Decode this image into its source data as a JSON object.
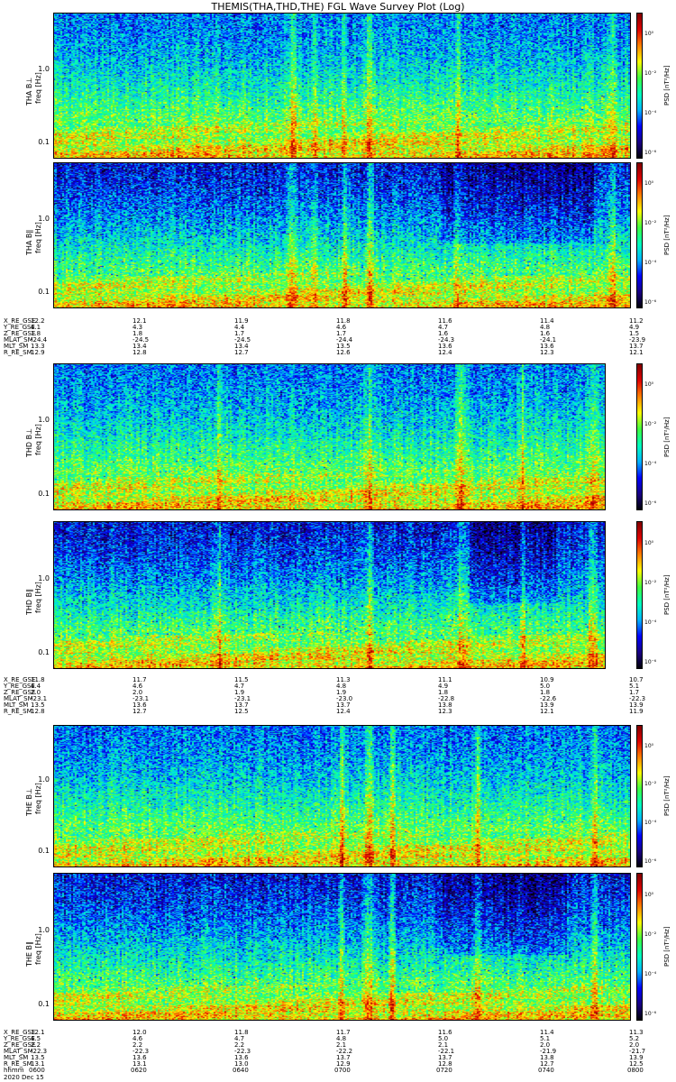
{
  "title": "THEMIS(THA,THD,THE) FGL Wave Survey Plot (Log)",
  "chart_data": [
    {
      "type": "heatmap",
      "probe": "THA",
      "panels": [
        {
          "ylabel_top": "THA B⊥",
          "ylabel_bottom": "freq [Hz]",
          "yscale": "log",
          "ylim": [
            0.06,
            6.0
          ],
          "yticks": [
            "1.0",
            "0.1"
          ],
          "colorbar_label": "PSD [nT²/Hz]",
          "colorbar_ticks": [
            "10⁰",
            "10⁻²",
            "10⁻⁴",
            "10⁻⁶"
          ]
        },
        {
          "ylabel_top": "THA B∥",
          "ylabel_bottom": "freq [Hz]",
          "yscale": "log",
          "ylim": [
            0.06,
            6.0
          ],
          "yticks": [
            "1.0",
            "0.1"
          ],
          "colorbar_label": "PSD [nT²/Hz]",
          "colorbar_ticks": [
            "10⁰",
            "10⁻²",
            "10⁻⁴",
            "10⁻⁶"
          ]
        }
      ],
      "ephemeris": [
        {
          "name": "X_RE_GSE",
          "values": [
            "12.2",
            "12.1",
            "11.9",
            "11.8",
            "11.6",
            "11.4",
            "11.2"
          ]
        },
        {
          "name": "Y_RE_GSE",
          "values": [
            "4.1",
            "4.3",
            "4.4",
            "4.6",
            "4.7",
            "4.8",
            "4.9"
          ]
        },
        {
          "name": "Z_RE_GSE",
          "values": [
            "1.8",
            "1.8",
            "1.7",
            "1.7",
            "1.6",
            "1.6",
            "1.5"
          ]
        },
        {
          "name": "MLAT_SM",
          "values": [
            "-24.4",
            "-24.5",
            "-24.5",
            "-24.4",
            "-24.3",
            "-24.1",
            "-23.9"
          ]
        },
        {
          "name": "MLT_SM",
          "values": [
            "13.3",
            "13.4",
            "13.4",
            "13.5",
            "13.6",
            "13.6",
            "13.7"
          ]
        },
        {
          "name": "R_RE_SM",
          "values": [
            "12.9",
            "12.8",
            "12.7",
            "12.6",
            "12.4",
            "12.3",
            "12.1"
          ]
        }
      ]
    },
    {
      "type": "heatmap",
      "probe": "THD",
      "panels": [
        {
          "ylabel_top": "THD B⊥",
          "ylabel_bottom": "freq [Hz]",
          "yscale": "log",
          "ylim": [
            0.06,
            6.0
          ],
          "yticks": [
            "1.0",
            "0.1"
          ],
          "colorbar_label": "PSD [nT²/Hz]",
          "colorbar_ticks": [
            "10⁰",
            "10⁻²",
            "10⁻⁴",
            "10⁻⁶"
          ]
        },
        {
          "ylabel_top": "THD B∥",
          "ylabel_bottom": "freq [Hz]",
          "yscale": "log",
          "ylim": [
            0.06,
            6.0
          ],
          "yticks": [
            "1.0",
            "0.1"
          ],
          "colorbar_label": "PSD [nT²/Hz]",
          "colorbar_ticks": [
            "10⁰",
            "10⁻²",
            "10⁻⁴",
            "10⁻⁶"
          ]
        }
      ],
      "ephemeris": [
        {
          "name": "X_RE_GSE",
          "values": [
            "11.8",
            "11.7",
            "11.5",
            "11.3",
            "11.1",
            "10.9",
            "10.7"
          ]
        },
        {
          "name": "Y_RE_GSE",
          "values": [
            "4.4",
            "4.6",
            "4.7",
            "4.8",
            "4.9",
            "5.0",
            "5.1"
          ]
        },
        {
          "name": "Z_RE_GSE",
          "values": [
            "2.0",
            "2.0",
            "1.9",
            "1.9",
            "1.8",
            "1.8",
            "1.7"
          ]
        },
        {
          "name": "MLAT_SM",
          "values": [
            "-23.1",
            "-23.1",
            "-23.1",
            "-23.0",
            "-22.8",
            "-22.6",
            "-22.3"
          ]
        },
        {
          "name": "MLT_SM",
          "values": [
            "13.5",
            "13.6",
            "13.7",
            "13.7",
            "13.8",
            "13.9",
            "13.9"
          ]
        },
        {
          "name": "R_RE_SM",
          "values": [
            "12.8",
            "12.7",
            "12.5",
            "12.4",
            "12.3",
            "12.1",
            "11.9"
          ]
        }
      ]
    },
    {
      "type": "heatmap",
      "probe": "THE",
      "panels": [
        {
          "ylabel_top": "THE B⊥",
          "ylabel_bottom": "freq [Hz]",
          "yscale": "log",
          "ylim": [
            0.06,
            6.0
          ],
          "yticks": [
            "1.0",
            "0.1"
          ],
          "colorbar_label": "PSD [nT²/Hz]",
          "colorbar_ticks": [
            "10⁰",
            "10⁻²",
            "10⁻⁴",
            "10⁻⁶"
          ]
        },
        {
          "ylabel_top": "THE B∥",
          "ylabel_bottom": "freq [Hz]",
          "yscale": "log",
          "ylim": [
            0.06,
            6.0
          ],
          "yticks": [
            "1.0",
            "0.1"
          ],
          "colorbar_label": "PSD [nT²/Hz]",
          "colorbar_ticks": [
            "10⁰",
            "10⁻²",
            "10⁻⁴",
            "10⁻⁶"
          ]
        }
      ],
      "ephemeris": [
        {
          "name": "X_RE_GSE",
          "values": [
            "12.1",
            "12.0",
            "11.8",
            "11.7",
            "11.6",
            "11.4",
            "11.3"
          ]
        },
        {
          "name": "Y_RE_GSE",
          "values": [
            "4.5",
            "4.6",
            "4.7",
            "4.8",
            "5.0",
            "5.1",
            "5.2"
          ]
        },
        {
          "name": "Z_RE_GSE",
          "values": [
            "2.2",
            "2.2",
            "2.2",
            "2.1",
            "2.1",
            "2.0",
            "2.0"
          ]
        },
        {
          "name": "MLAT_SM",
          "values": [
            "-22.3",
            "-22.3",
            "-22.3",
            "-22.2",
            "-22.1",
            "-21.9",
            "-21.7"
          ]
        },
        {
          "name": "MLT_SM",
          "values": [
            "13.5",
            "13.6",
            "13.6",
            "13.7",
            "13.7",
            "13.8",
            "13.9"
          ]
        },
        {
          "name": "R_RE_SM",
          "values": [
            "13.1",
            "13.1",
            "13.0",
            "12.9",
            "12.8",
            "12.7",
            "12.5"
          ]
        }
      ],
      "time_axis": {
        "label": "hhmm",
        "ticks": [
          "0600",
          "0620",
          "0640",
          "0700",
          "0720",
          "0740",
          "0800"
        ],
        "date": "2020 Dec 15"
      }
    }
  ],
  "colors": {
    "colormap": [
      "#000000",
      "#1a0080",
      "#0000ff",
      "#00b4ff",
      "#00ffc0",
      "#40ff40",
      "#ffff00",
      "#ff8000",
      "#e00000",
      "#800000"
    ]
  }
}
